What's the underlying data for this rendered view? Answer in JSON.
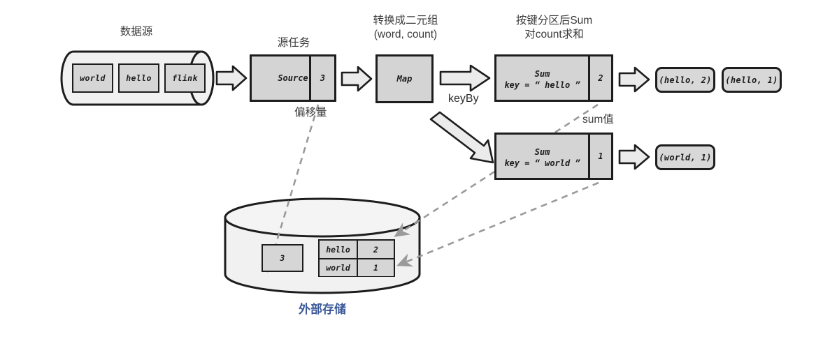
{
  "diagram": {
    "title_source": "数据源",
    "title_source_task": "源任务",
    "title_map_line1": "转换成二元组",
    "title_map_line2": "(word, count)",
    "title_sum_line1": "按键分区后Sum",
    "title_sum_line2": "对count求和",
    "label_offset": "偏移量",
    "label_sumvalue": "sum值",
    "label_keyby": "keyBy",
    "label_storage": "外部存储"
  },
  "source_records": [
    {
      "text": "world"
    },
    {
      "text": "hello"
    },
    {
      "text": "flink"
    }
  ],
  "source_task": {
    "op_label": "Source",
    "offset_value": "3"
  },
  "map_task": {
    "op_label": "Map"
  },
  "sum_tasks": [
    {
      "op_line1": "Sum",
      "op_line2": "key = “ hello ”",
      "sum_value": "2"
    },
    {
      "op_line1": "Sum",
      "op_line2": "key = “ world ”",
      "sum_value": "1"
    }
  ],
  "outputs": [
    {
      "text": "(hello, 2)"
    },
    {
      "text": "(hello, 1)"
    },
    {
      "text": "(world, 1)"
    }
  ],
  "external_storage": {
    "offset_cell": "3",
    "state_rows": [
      {
        "key": "hello",
        "value": "2"
      },
      {
        "key": "world",
        "value": "1"
      }
    ]
  },
  "colors": {
    "box_fill": "#d6d6d6",
    "outline": "#1d1d1d",
    "arrow_fill": "#eaeaea",
    "dashed_line": "#9a9a9a",
    "storage_label": "#3c5a99",
    "cylinder_fill": "#f1f1f1"
  }
}
